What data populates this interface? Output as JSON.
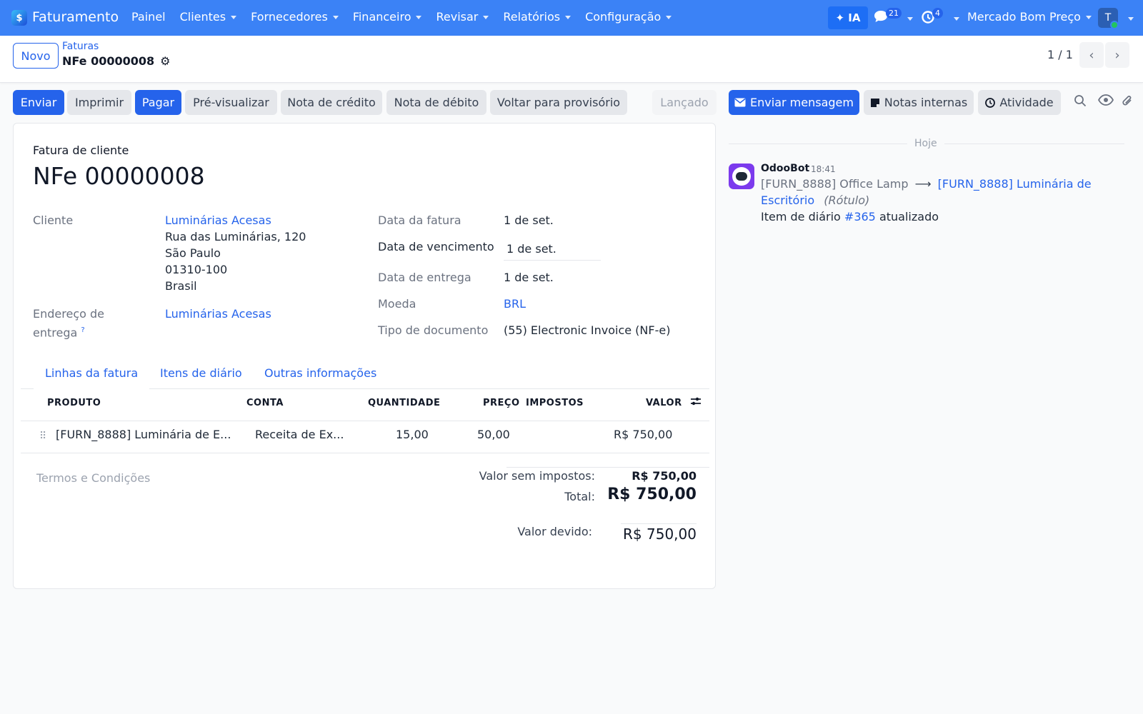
{
  "navbar": {
    "app_name": "Faturamento",
    "menu": [
      "Painel",
      "Clientes",
      "Fornecedores",
      "Financeiro",
      "Revisar",
      "Relatórios",
      "Configuração"
    ],
    "ia_label": "✦ IA",
    "messages_count": "21",
    "activities_count": "4",
    "company": "Mercado Bom Preço",
    "user_initial": "T"
  },
  "control": {
    "new_label": "Novo",
    "breadcrumb": "Faturas",
    "record_title": "NFe 00000008",
    "pager": "1 / 1"
  },
  "actions": {
    "send": "Enviar",
    "print": "Imprimir",
    "pay": "Pagar",
    "preview": "Pré-visualizar",
    "credit_note": "Nota de crédito",
    "debit_note": "Nota de débito",
    "back_draft": "Voltar para provisório",
    "status": "Lançado"
  },
  "chatter_buttons": {
    "send_message": "Enviar mensagem",
    "internal_notes": "Notas internas",
    "activity": "Atividade"
  },
  "form": {
    "subtitle": "Fatura de cliente",
    "title": "NFe 00000008",
    "customer_label": "Cliente",
    "customer_name": "Luminárias Acesas",
    "address": [
      "Rua das Luminárias, 120",
      "São Paulo",
      "01310-100",
      "Brasil"
    ],
    "delivery_label_1": "Endereço de",
    "delivery_label_2": "entrega",
    "delivery_help": "?",
    "delivery_value": "Luminárias Acesas",
    "invoice_date_label": "Data da fatura",
    "invoice_date": "1 de set.",
    "due_date_label": "Data de vencimento",
    "due_date": "1 de set.",
    "delivery_date_label": "Data de entrega",
    "delivery_date": "1 de set.",
    "currency_label": "Moeda",
    "currency": "BRL",
    "doc_type_label": "Tipo de documento",
    "doc_type": "(55) Electronic Invoice (NF-e)"
  },
  "tabs": [
    "Linhas da fatura",
    "Itens de diário",
    "Outras informações"
  ],
  "table": {
    "headers": [
      "PRODUTO",
      "CONTA",
      "QUANTIDADE",
      "PREÇO",
      "IMPOSTOS",
      "VALOR"
    ],
    "row": {
      "product": "[FURN_8888] Luminária de E...",
      "account": "Receita de Ex...",
      "quantity": "15,00",
      "price": "50,00",
      "taxes": "",
      "amount": "R$ 750,00"
    }
  },
  "totals": {
    "terms_placeholder": "Termos e Condições",
    "untaxed_label": "Valor sem impostos:",
    "untaxed": "R$ 750,00",
    "total_label": "Total:",
    "total": "R$ 750,00",
    "due_label": "Valor devido:",
    "due": "R$ 750,00"
  },
  "chatter": {
    "today": "Hoje",
    "author": "OdooBot",
    "time": "18:41",
    "old_value": "[FURN_8888] Office Lamp",
    "arrow": "⟶",
    "new_value_1": "[FURN_8888] Luminária de",
    "new_value_2": "Escritório",
    "field_name": "(Rótulo)",
    "journal_prefix": "Item de diário",
    "journal_ref": "#365",
    "journal_suffix": "atualizado"
  },
  "colors": {
    "navbar": "#3b82f6",
    "primary": "#2563eb"
  }
}
